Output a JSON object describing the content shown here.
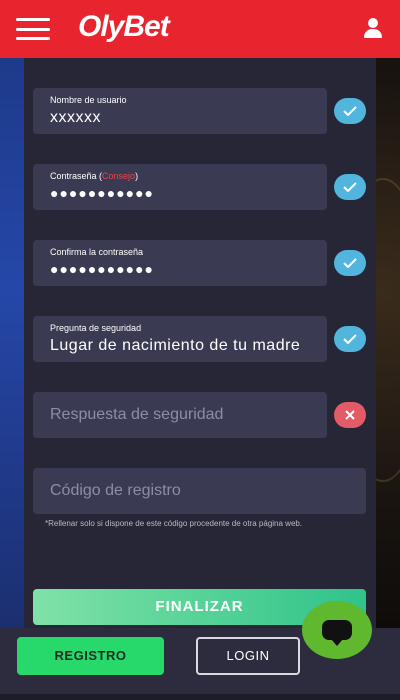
{
  "header": {
    "logo": "OlyBet",
    "menu_icon": "hamburger-menu-icon",
    "user_icon": "user-icon",
    "background_color": "#e8252e"
  },
  "form": {
    "username": {
      "label": "Nombre de usuario",
      "value": "xxxxxx",
      "status": "valid"
    },
    "password": {
      "label_main": "Contraseña",
      "label_open": " (",
      "label_hint": "Consejo",
      "label_close": ")",
      "value": "●●●●●●●●●●●",
      "status": "valid"
    },
    "confirm_password": {
      "label": "Confirma la contraseña",
      "value": "●●●●●●●●●●●",
      "status": "valid"
    },
    "security_question": {
      "label": "Pregunta de seguridad",
      "value": "Lugar de nacimiento de tu madre",
      "status": "valid"
    },
    "security_answer": {
      "placeholder": "Respuesta de seguridad",
      "status": "invalid"
    },
    "registration_code": {
      "placeholder": "Código de registro"
    },
    "note": "*Rellenar solo si dispone de este código procedente de otra página web.",
    "submit_label": "FINALIZAR"
  },
  "bottom_bar": {
    "register_label": "REGISTRO",
    "login_label": "LOGIN",
    "chat_icon": "chat-icon"
  },
  "colors": {
    "valid": "#52b5dd",
    "invalid": "#e25b67",
    "accent_green": "#27d86a"
  }
}
